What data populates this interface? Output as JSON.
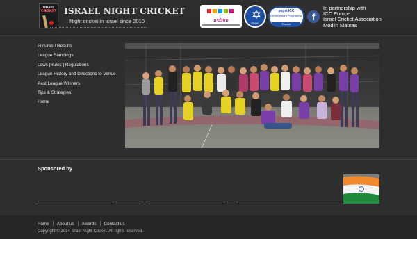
{
  "header": {
    "logo_text_top": "ISRAEL NIGHT",
    "logo_text_bottom": "CRICKET",
    "title": "ISRAEL NIGHT CRICKET",
    "tagline": "Night cricket in Israel since 2010",
    "partnership_lines": [
      "In partnership with",
      "ICC Europe",
      "Israel Cricket Association",
      "Mod'in Matnas"
    ],
    "partner_logos": {
      "logo1": "סחלבים",
      "logo2": "ISRAEL",
      "logo3_l1": "pepsi ICC",
      "logo3_l2": "Development Programme",
      "logo3_l3": "Europe"
    },
    "facebook_icon": "f"
  },
  "nav": {
    "items": [
      {
        "label": "Fixtures / Results"
      },
      {
        "label": "League Standings"
      },
      {
        "label": "Laws |Rules | Regulations"
      },
      {
        "label": "League History and Directions to Venue"
      },
      {
        "label": "Past League Winners"
      },
      {
        "label": "Tips & Strategies"
      },
      {
        "label": "Home"
      }
    ]
  },
  "sponsored": {
    "heading": "Sponsored by"
  },
  "footer": {
    "links": [
      "Home",
      "About us",
      "Awards",
      "Contact us"
    ],
    "copyright": "Copyright © 2014 Israel Night Cricket. All rights reserved."
  },
  "colors": {
    "background": "#2e2e2e",
    "footer": "#262626",
    "facebook": "#3b5998",
    "text": "#f0f0f0"
  }
}
